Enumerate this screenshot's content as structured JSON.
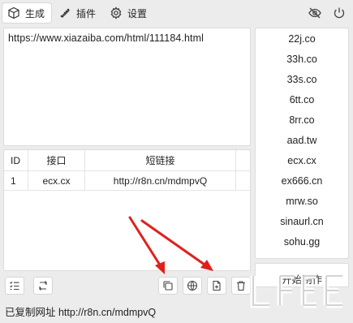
{
  "tabs": [
    {
      "label": "生成",
      "icon": "cube-icon",
      "active": true
    },
    {
      "label": "插件",
      "icon": "puzzle-icon",
      "active": false
    },
    {
      "label": "设置",
      "icon": "gear-icon",
      "active": false
    }
  ],
  "top_right_icons": [
    "eye-off-icon",
    "power-icon"
  ],
  "url_input": "https://www.xiazaiba.com/html/111184.html",
  "table": {
    "headers": {
      "id": "ID",
      "host": "接口",
      "short": "短链接"
    },
    "rows": [
      {
        "id": "1",
        "host": "ecx.cx",
        "short": "http://r8n.cn/mdmpvQ"
      }
    ]
  },
  "domains": [
    "22j.co",
    "33h.co",
    "33s.co",
    "6tt.co",
    "8rr.co",
    "aad.tw",
    "ecx.cx",
    "ex666.cn",
    "mrw.so",
    "sinaurl.cn",
    "sohu.gg"
  ],
  "start_button": "开始制作",
  "toolbar_icons": [
    "checklist-icon",
    "swap-icon",
    "copy-icon",
    "web-icon",
    "export-file-icon",
    "trash-icon"
  ],
  "status_text": "已复制网址 http://r8n.cn/mdmpvQ",
  "colors": {
    "arrow": "#e0201c",
    "panel_bg": "#ffffff",
    "app_bg": "#ececec"
  }
}
